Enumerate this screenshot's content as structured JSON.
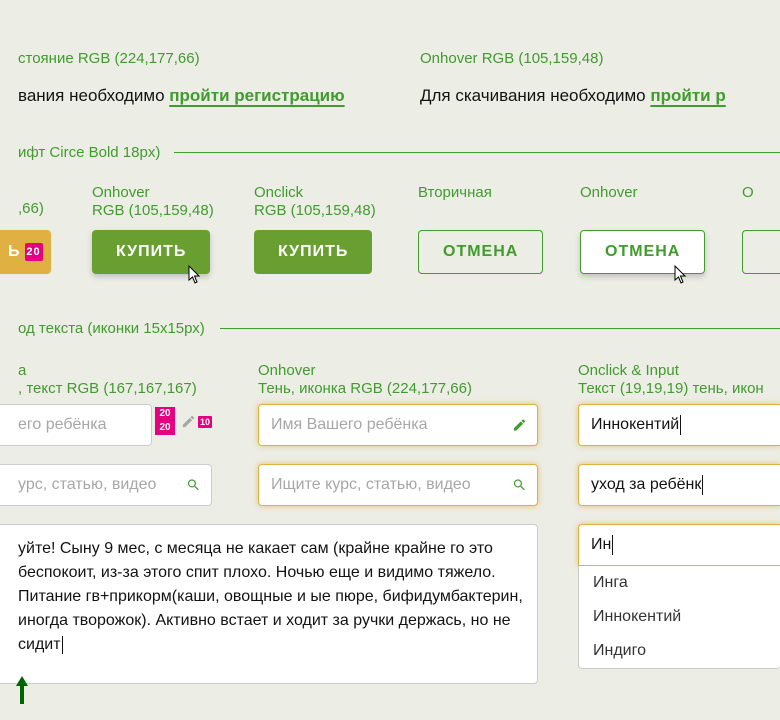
{
  "section1": {
    "leftLabel": "стояние RGB (224,177,66)",
    "rightLabel": "Onhover RGB (105,159,48)",
    "downloadPrefix": "вания необходимо ",
    "downloadPrefixFull": "Для скачивания необходимо ",
    "registerLink": "пройти регистрацию",
    "registerLinkCut": "пройти р"
  },
  "section2": {
    "title": "ифт Circe Bold 18px)",
    "labels": {
      "partial": ",66)",
      "hover": "Onhover",
      "hoverRGB": "RGB (105,159,48)",
      "click": "Onclick",
      "clickRGB": "RGB (105,159,48)",
      "secondary": "Вторичная",
      "secHover": "Onhover",
      "secClick": "O"
    },
    "buttons": {
      "buyPartial": "Ь",
      "badge20": "20",
      "buy": "КУПИТЬ",
      "cancel": "ОТМЕНА"
    }
  },
  "section3": {
    "title": "од текста (иконки 15х15рх)",
    "labels": {
      "leftCut": "а",
      "leftRGB": ", текст RGB (167,167,167)",
      "hover": "Onhover",
      "hoverDesc": "Тень, иконка RGB (224,177,66)",
      "click": "Onclick & Input",
      "clickDesc": "Текст (19,19,19) тень, икон"
    },
    "inputs": {
      "namePlaceholderCut": "его ребёнка",
      "namePlaceholder": "Имя Вашего ребёнка",
      "nameValue": "Иннокентий",
      "searchPlaceholderCut": "урс, статью, видео",
      "searchPlaceholder": "Ищите курс, статью, видео",
      "searchValue": "уход за ребёнк",
      "autoValue": "Ин",
      "cal1": "20",
      "cal2": "20",
      "badge10": "10"
    },
    "textarea": "уйте! Сыну 9 мес, с месяца не какает сам (крайне крайне го это беспокоит, из-за этого спит плохо. Ночью еще и видимо тяжело. Питание гв+прикорм(каши, овощные и ые пюре, бифидумбактерин, иногда творожок). Активно встает и ходит за ручки держась, но не сидит",
    "dropdown": [
      "Инга",
      "Иннокентий",
      "Индиго"
    ]
  }
}
